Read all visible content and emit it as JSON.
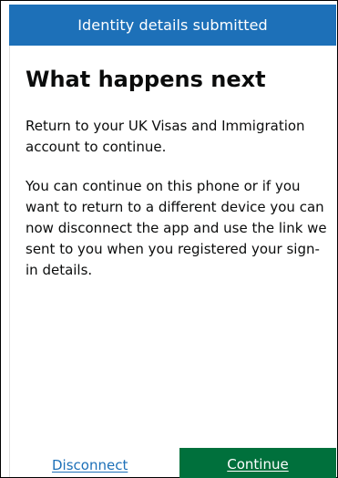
{
  "header": {
    "title": "Identity details submitted"
  },
  "main": {
    "heading": "What happens next",
    "paragraphs": [
      "Return to your UK Visas and Immigration account to continue.",
      "You can continue on this phone or if you want to return to a different device you can now disconnect the app and use the link we sent to you when you registered your sign-in details."
    ]
  },
  "actions": {
    "disconnect_label": "Disconnect",
    "continue_label": "Continue"
  },
  "colors": {
    "header_background": "#1d70b8",
    "link": "#1d70b8",
    "primary_button": "#00703c",
    "text": "#0b0c0c"
  }
}
